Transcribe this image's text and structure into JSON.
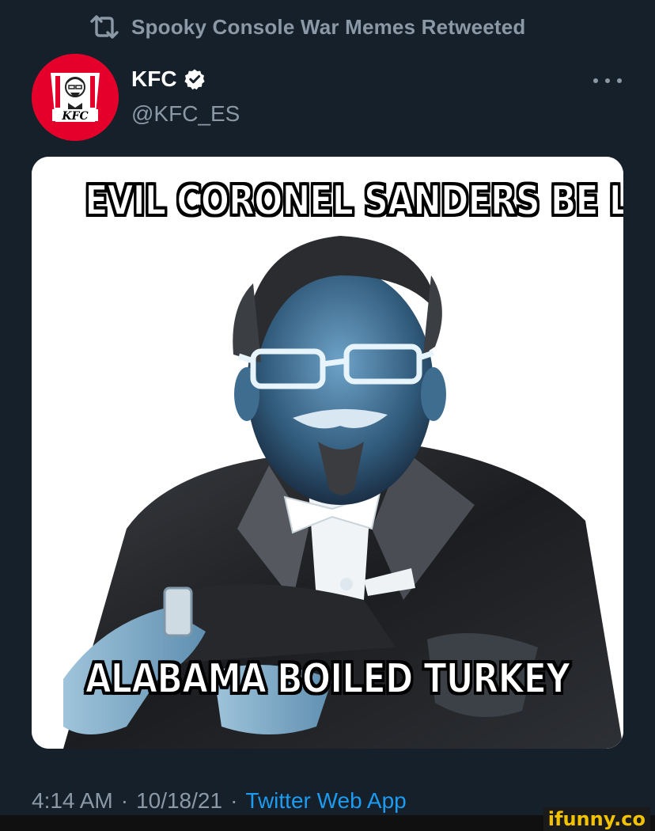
{
  "retweet": {
    "label": "Spooky Console War Memes Retweeted",
    "icon": "retweet-icon"
  },
  "author": {
    "display_name": "KFC",
    "handle": "@KFC_ES",
    "avatar_text": "KFC",
    "verified_icon": "verified-badge-icon"
  },
  "more_icon": "more-options-icon",
  "media": {
    "caption_top": "EVIL CORONEL SANDERS BE LIKE",
    "caption_bottom": "ALABAMA BOILED TURKEY"
  },
  "meta": {
    "time": "4:14 AM",
    "separator": "·",
    "date": "10/18/21",
    "source": "Twitter Web App"
  },
  "watermark": "ifunny.co",
  "colors": {
    "background": "#15202b",
    "secondary_text": "#8b98a5",
    "link": "#1d9bf0",
    "kfc_red": "#e4002b",
    "verified_blue": "#1d9bf0"
  }
}
